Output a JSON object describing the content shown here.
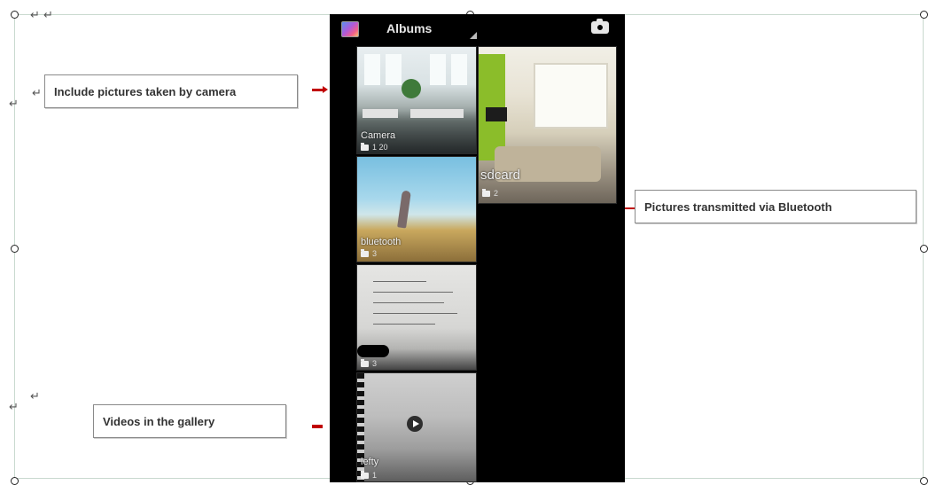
{
  "phone": {
    "title": "Albums",
    "icons": {
      "app": "gallery-app-icon",
      "camera": "camera-icon",
      "overflow": "overflow-triangle-icon"
    },
    "albums": {
      "camera": {
        "label": "Camera",
        "count": "1 20"
      },
      "sdcard": {
        "label": "sdcard",
        "count": "2"
      },
      "bluetooth": {
        "label": "bluetooth",
        "count": "3"
      },
      "notes": {
        "label": "",
        "count": "3"
      },
      "video": {
        "label": "lefty",
        "count": "1"
      }
    }
  },
  "callouts": {
    "camera": "Include pictures taken by camera",
    "bluetooth": "Pictures transmitted via Bluetooth",
    "videos": "Videos in the gallery"
  },
  "document": {
    "paragraph_mark": "↵",
    "double_mark": "↵ ↵"
  },
  "colors": {
    "accent_line": "#c00000",
    "phone_bg": "#000000"
  }
}
